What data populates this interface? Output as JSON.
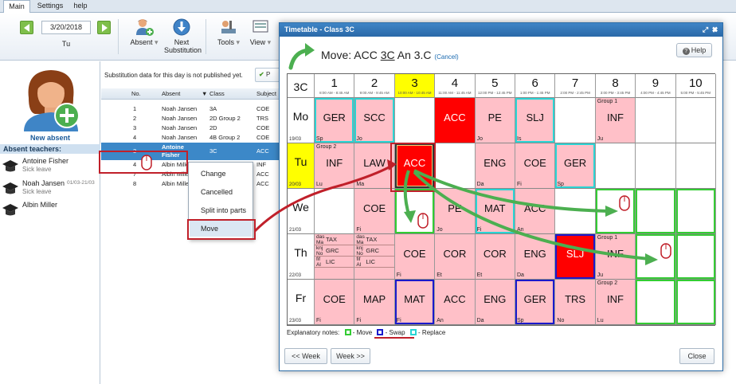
{
  "menu": {
    "tabs": [
      "Main",
      "Settings",
      "help"
    ]
  },
  "ribbon": {
    "date": "3/20/2018",
    "day": "Tu",
    "absent_label": "Absent",
    "next_sub_line1": "Next",
    "next_sub_line2": "Substitution",
    "tools_label": "Tools",
    "view_label": "View"
  },
  "left": {
    "new_absent": "New absent",
    "absent_teachers": "Absent teachers:",
    "teachers": [
      {
        "name": "Antoine Fisher",
        "sub": "Sick leave",
        "date": ""
      },
      {
        "name": "Noah Jansen",
        "sub": "Sick leave",
        "date": "01/03-21/03"
      },
      {
        "name": "Albin Miller",
        "sub": "",
        "date": ""
      }
    ]
  },
  "subs": {
    "notice": "Substitution data for this day is not published yet.",
    "publish_btn": "P",
    "columns": [
      "No.",
      "Absent",
      "Class",
      "Subject"
    ],
    "rows": [
      {
        "no": "1",
        "absent": "Noah Jansen",
        "cls": "3A",
        "subj": "COE"
      },
      {
        "no": "2",
        "absent": "Noah Jansen",
        "cls": "2D Group 2",
        "subj": "TRS"
      },
      {
        "no": "3",
        "absent": "Noah Jansen",
        "cls": "2D",
        "subj": "COE"
      },
      {
        "no": "4",
        "absent": "Noah Jansen",
        "cls": "4B Group 2",
        "subj": "COE"
      },
      {
        "no": "3",
        "absent": "Antoine\nFisher",
        "cls": "3C",
        "subj": "ACC"
      },
      {
        "no": "4",
        "absent": "Albin Mille",
        "cls": "",
        "subj": "INF"
      },
      {
        "no": "7",
        "absent": "Albin Mille",
        "cls": "",
        "subj": "ACC"
      },
      {
        "no": "8",
        "absent": "Albin Mille",
        "cls": "",
        "subj": "ACC"
      }
    ],
    "context_menu": [
      "Change",
      "Cancelled",
      "Split into parts",
      "Move"
    ]
  },
  "dialog": {
    "title": "Timetable - Class 3C",
    "move_prefix": "Move: ACC ",
    "move_class": "3C",
    "move_suffix": " An 3.C ",
    "cancel": "(Cancel)",
    "help": "Help",
    "class_label": "3C",
    "periods": [
      {
        "n": "1",
        "t": "8:00 AM - 8:45 AM"
      },
      {
        "n": "2",
        "t": "9:00 AM - 9:45 AM"
      },
      {
        "n": "3",
        "t": "10:00 AM - 10:45 AM"
      },
      {
        "n": "4",
        "t": "11:00 AM - 11:45 AM"
      },
      {
        "n": "5",
        "t": "12:00 PM - 12:45 PM"
      },
      {
        "n": "6",
        "t": "1:00 PM - 1:45 PM"
      },
      {
        "n": "7",
        "t": "2:00 PM - 2:45 PM"
      },
      {
        "n": "8",
        "t": "3:00 PM - 3:45 PM"
      },
      {
        "n": "9",
        "t": "4:00 PM - 4:45 PM"
      },
      {
        "n": "10",
        "t": "5:00 PM - 5:45 PM"
      }
    ],
    "days": [
      {
        "n": "Mo",
        "d": "19/03"
      },
      {
        "n": "Tu",
        "d": "20/03"
      },
      {
        "n": "We",
        "d": "21/03"
      },
      {
        "n": "Th",
        "d": "22/03"
      },
      {
        "n": "Fr",
        "d": "23/03"
      }
    ],
    "cells": [
      [
        {
          "s": "GER",
          "t": "Sp",
          "st": "p cy"
        },
        {
          "s": "SCC",
          "t": "Jo",
          "st": "p cy"
        },
        {
          "s": "",
          "t": "",
          "st": ""
        },
        {
          "s": "ACC",
          "t": "",
          "st": "r"
        },
        {
          "s": "PE",
          "t": "Jo",
          "st": "p"
        },
        {
          "s": "SLJ",
          "t": "Is",
          "st": "p cy"
        },
        {
          "s": "",
          "t": "",
          "st": ""
        },
        {
          "s": "INF",
          "t": "Ju",
          "g": "Group 1",
          "st": "p"
        },
        {
          "s": "",
          "t": "",
          "st": ""
        },
        {
          "s": "",
          "t": "",
          "st": ""
        }
      ],
      [
        {
          "s": "INF",
          "t": "Lu",
          "g": "Group 2",
          "st": "p"
        },
        {
          "s": "LAW",
          "t": "Ma",
          "st": "p"
        },
        {
          "s": "ACC",
          "t": "",
          "st": "r sel"
        },
        {
          "s": "",
          "t": "",
          "st": ""
        },
        {
          "s": "ENG",
          "t": "Da",
          "st": "p"
        },
        {
          "s": "COE",
          "t": "Fi",
          "st": "p"
        },
        {
          "s": "GER",
          "t": "Sp",
          "st": "p cy"
        },
        {
          "s": "",
          "t": "",
          "st": ""
        },
        {
          "s": "",
          "t": "",
          "st": ""
        },
        {
          "s": "",
          "t": "",
          "st": ""
        }
      ],
      [
        {
          "s": "",
          "t": "",
          "st": ""
        },
        {
          "s": "COE",
          "t": "Fi",
          "st": "p"
        },
        {
          "s": "",
          "t": "",
          "st": "gr"
        },
        {
          "s": "PE",
          "t": "Jo",
          "st": "p"
        },
        {
          "s": "MAT",
          "t": "Fi",
          "st": "p cy"
        },
        {
          "s": "ACC",
          "t": "An",
          "st": "p"
        },
        {
          "s": "",
          "t": "",
          "st": ""
        },
        {
          "s": "",
          "t": "",
          "st": "gr"
        },
        {
          "s": "",
          "t": "",
          "st": "gr"
        },
        {
          "s": "",
          "t": "",
          "st": "gr"
        }
      ],
      [
        {
          "s": "",
          "t": "",
          "st": "p",
          "mini": [
            [
              "das",
              "TAX",
              "Ma"
            ],
            [
              "knj",
              "GRC",
              "No"
            ],
            [
              "fif",
              "LIC",
              "Al"
            ]
          ]
        },
        {
          "s": "",
          "t": "",
          "st": "p",
          "mini": [
            [
              "das",
              "TAX",
              "Ma"
            ],
            [
              "knj",
              "GRC",
              "No"
            ],
            [
              "fif",
              "LIC",
              "Al"
            ]
          ]
        },
        {
          "s": "COE",
          "t": "Fi",
          "st": "p"
        },
        {
          "s": "COR",
          "t": "Et",
          "st": "p"
        },
        {
          "s": "COR",
          "t": "Et",
          "st": "p"
        },
        {
          "s": "ENG",
          "t": "Da",
          "st": "p"
        },
        {
          "s": "SLJ",
          "t": "",
          "st": "r bl"
        },
        {
          "s": "INF",
          "t": "Ju",
          "g": "Group 1",
          "st": "p"
        },
        {
          "s": "",
          "t": "",
          "st": "gr"
        },
        {
          "s": "",
          "t": "",
          "st": "gr"
        }
      ],
      [
        {
          "s": "COE",
          "t": "Fi",
          "st": "p"
        },
        {
          "s": "MAP",
          "t": "Fi",
          "st": "p"
        },
        {
          "s": "MAT",
          "t": "Fi",
          "st": "p bl"
        },
        {
          "s": "ACC",
          "t": "An",
          "st": "p"
        },
        {
          "s": "ENG",
          "t": "Da",
          "st": "p"
        },
        {
          "s": "GER",
          "t": "Sp",
          "st": "p bl"
        },
        {
          "s": "TRS",
          "t": "No",
          "st": "p"
        },
        {
          "s": "INF",
          "t": "Lu",
          "g": "Group 2",
          "st": "p"
        },
        {
          "s": "",
          "t": "",
          "st": "gr"
        },
        {
          "s": "",
          "t": "",
          "st": "gr"
        }
      ]
    ],
    "legend_label": "Explanatory notes:",
    "legend": [
      "- Move",
      "- Swap",
      "- Replace"
    ],
    "prev_week": "<< Week",
    "next_week": "Week >>",
    "close": "Close"
  },
  "colors": {
    "class_cell": "#ffc0c8",
    "absent_cell": "#ff0000",
    "today": "#ffff00",
    "move": "#33cc33",
    "swap": "#1a1acc",
    "replace": "#2ad4d4",
    "arrow": "#c0202a"
  }
}
